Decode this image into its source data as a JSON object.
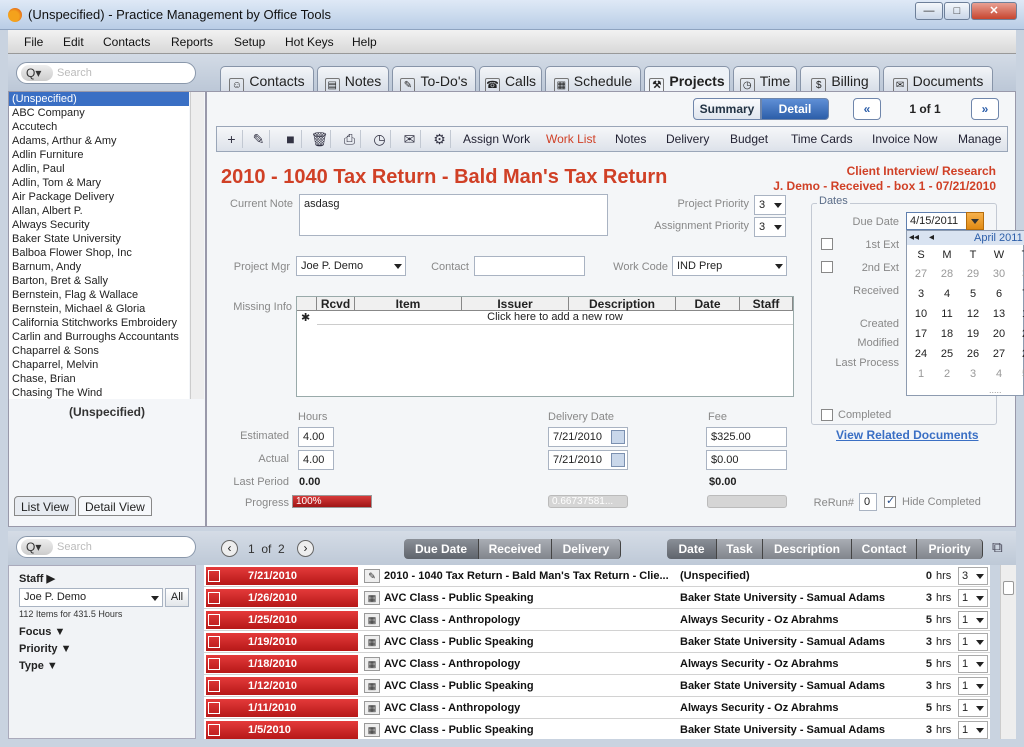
{
  "window": {
    "title": "(Unspecified) - Practice Management by Office Tools",
    "btn_min": "—",
    "btn_max": "□",
    "btn_close": "✕"
  },
  "menu": [
    "File",
    "Edit",
    "Contacts",
    "Reports",
    "Setup",
    "Hot Keys",
    "Help"
  ],
  "search": {
    "placeholder": "Search",
    "mag": "Q▾"
  },
  "tabs": [
    {
      "label": "Contacts",
      "icon": "contacts-icon",
      "glyph": "☺"
    },
    {
      "label": "Notes",
      "icon": "notes-icon",
      "glyph": "▤"
    },
    {
      "label": "To-Do's",
      "icon": "todo-icon",
      "glyph": "✎"
    },
    {
      "label": "Calls",
      "icon": "phone-icon",
      "glyph": "☎"
    },
    {
      "label": "Schedule",
      "icon": "calendar-icon",
      "glyph": "▦"
    },
    {
      "label": "Projects",
      "icon": "projects-icon",
      "glyph": "⚒"
    },
    {
      "label": "Time",
      "icon": "clock-icon",
      "glyph": "◷"
    },
    {
      "label": "Billing",
      "icon": "billing-icon",
      "glyph": "$"
    },
    {
      "label": "Documents",
      "icon": "documents-icon",
      "glyph": "✉"
    }
  ],
  "clients": [
    "(Unspecified)",
    "ABC Company",
    "Accutech",
    "Adams, Arthur & Amy",
    "Adlin Furniture",
    "Adlin, Paul",
    "Adlin, Tom & Mary",
    "Air Package Delivery",
    "Allan, Albert P.",
    "Always Security",
    "Baker State University",
    "Balboa Flower Shop, Inc",
    "Barnum, Andy",
    "Barton, Bret & Sally",
    "Bernstein, Flag & Wallace",
    "Bernstein, Michael & Gloria",
    "California Stitchworks Embroidery",
    "Carlin and Burroughs Accountants",
    "Chaparrel & Sons",
    "Chaparrel, Melvin",
    "Chase, Brian",
    "Chasing The Wind"
  ],
  "left": {
    "selected": "(Unspecified)",
    "list_view": "List View",
    "detail_view": "Detail View"
  },
  "view": {
    "summary": "Summary",
    "detail": "Detail",
    "prev": "«",
    "next": "»",
    "pager": "1 of 1"
  },
  "toolbar": {
    "icons": [
      "+",
      "✎",
      "■",
      "🗑",
      "⎙",
      "◷",
      "✉",
      "⚙"
    ],
    "links": [
      "Assign Work",
      "Work List",
      "Notes",
      "Delivery",
      "Budget",
      "Time Cards",
      "Invoice Now",
      "Manage"
    ]
  },
  "project": {
    "title": "2010 - 1040 Tax Return - Bald Man's Tax Return",
    "status1": "Client Interview/ Research",
    "status2": "J. Demo - Received - box 1 - 07/21/2010",
    "current_note_label": "Current Note",
    "current_note": "asdasg",
    "priority_label": "Project Priority",
    "priority": "3",
    "assign_priority_label": "Assignment Priority",
    "assign_priority": "3",
    "mgr_label": "Project Mgr",
    "mgr": "Joe P. Demo",
    "contact_label": "Contact",
    "contact": "",
    "work_code_label": "Work Code",
    "work_code": "IND Prep",
    "missing_label": "Missing Info",
    "grid_cols": [
      "Rcvd",
      "Item",
      "Issuer",
      "Description",
      "Date",
      "Staff"
    ],
    "grid_add": "Click here to add a new row",
    "grid_star": "✱",
    "hours_label": "Hours",
    "delivery_label": "Delivery Date",
    "fee_label": "Fee",
    "estimated_label": "Estimated",
    "estimated_hours": "4.00",
    "estimated_date": "7/21/2010",
    "estimated_fee": "$325.00",
    "actual_label": "Actual",
    "actual_hours": "4.00",
    "actual_date": "7/21/2010",
    "actual_fee": "$0.00",
    "last_period_label": "Last Period",
    "last_period_hours": "0.00",
    "last_period_fee": "$0.00",
    "progress_label": "Progress",
    "progress_text": "100%",
    "progress": 1.0,
    "mid_bar_text": "0.66737581...",
    "rerun_label": "ReRun#",
    "rerun": "0",
    "hide_completed": "Hide Completed"
  },
  "dates": {
    "group": "Dates",
    "due_label": "Due Date",
    "due": "4/15/2011",
    "first_ext": "1st Ext",
    "second_ext": "2nd Ext",
    "received": "Received",
    "created": "Created",
    "modified": "Modified",
    "last_process": "Last Process",
    "completed": "Completed",
    "related": "View Related Documents"
  },
  "calendar": {
    "month": "April 2011",
    "nav_prev2": "◂◂",
    "nav_prev": "◂",
    "dow": [
      "S",
      "M",
      "T",
      "W",
      "T"
    ],
    "weeks": [
      [
        "27",
        "28",
        "29",
        "30",
        "3"
      ],
      [
        "3",
        "4",
        "5",
        "6",
        "7"
      ],
      [
        "10",
        "11",
        "12",
        "13",
        "1"
      ],
      [
        "17",
        "18",
        "19",
        "20",
        "2"
      ],
      [
        "24",
        "25",
        "26",
        "27",
        "2"
      ],
      [
        "1",
        "2",
        "3",
        "4",
        "5"
      ]
    ],
    "dots": "....."
  },
  "bottom": {
    "pager": "1  of  2",
    "prev": "‹",
    "next": "›",
    "sort_left": [
      "Due Date",
      "Received",
      "Delivery"
    ],
    "sort_right": [
      "Date",
      "Task",
      "Description",
      "Contact",
      "Priority"
    ],
    "popout": "⧉",
    "staff_label": "Staff ▶",
    "staff": "Joe P. Demo",
    "all_btn": "All",
    "items_count": "112 Items for 431.5 Hours",
    "focus": "Focus ▼",
    "priority": "Priority ▼",
    "type": "Type ▼"
  },
  "rows": [
    {
      "date": "7/21/2010",
      "desc": "2010 - 1040 Tax Return - Bald Man's Tax Return - Clie...",
      "contact": "(Unspecified)",
      "hours": "0",
      "unit": "hrs",
      "pri": "3",
      "icon": "pencil-icon",
      "glyph": "✎"
    },
    {
      "date": "1/26/2010",
      "desc": "AVC Class - Public Speaking",
      "contact": "Baker State University - Samual Adams",
      "hours": "3",
      "unit": "hrs",
      "pri": "1",
      "icon": "calendar-icon",
      "glyph": "▦"
    },
    {
      "date": "1/25/2010",
      "desc": "AVC Class - Anthropology",
      "contact": "Always Security - Oz Abrahms",
      "hours": "5",
      "unit": "hrs",
      "pri": "1",
      "icon": "calendar-icon",
      "glyph": "▦"
    },
    {
      "date": "1/19/2010",
      "desc": "AVC Class - Public Speaking",
      "contact": "Baker State University - Samual Adams",
      "hours": "3",
      "unit": "hrs",
      "pri": "1",
      "icon": "calendar-icon",
      "glyph": "▦"
    },
    {
      "date": "1/18/2010",
      "desc": "AVC Class - Anthropology",
      "contact": "Always Security - Oz Abrahms",
      "hours": "5",
      "unit": "hrs",
      "pri": "1",
      "icon": "calendar-icon",
      "glyph": "▦"
    },
    {
      "date": "1/12/2010",
      "desc": "AVC Class - Public Speaking",
      "contact": "Baker State University - Samual Adams",
      "hours": "3",
      "unit": "hrs",
      "pri": "1",
      "icon": "calendar-icon",
      "glyph": "▦"
    },
    {
      "date": "1/11/2010",
      "desc": "AVC Class - Anthropology",
      "contact": "Always Security - Oz Abrahms",
      "hours": "5",
      "unit": "hrs",
      "pri": "1",
      "icon": "calendar-icon",
      "glyph": "▦"
    },
    {
      "date": "1/5/2010",
      "desc": "AVC Class - Public Speaking",
      "contact": "Baker State University - Samual Adams",
      "hours": "3",
      "unit": "hrs",
      "pri": "1",
      "icon": "calendar-icon",
      "glyph": "▦"
    }
  ],
  "colors": {
    "accent": "#d04026",
    "selection": "#3a6fc4",
    "active_seg": "#3f74c6"
  }
}
